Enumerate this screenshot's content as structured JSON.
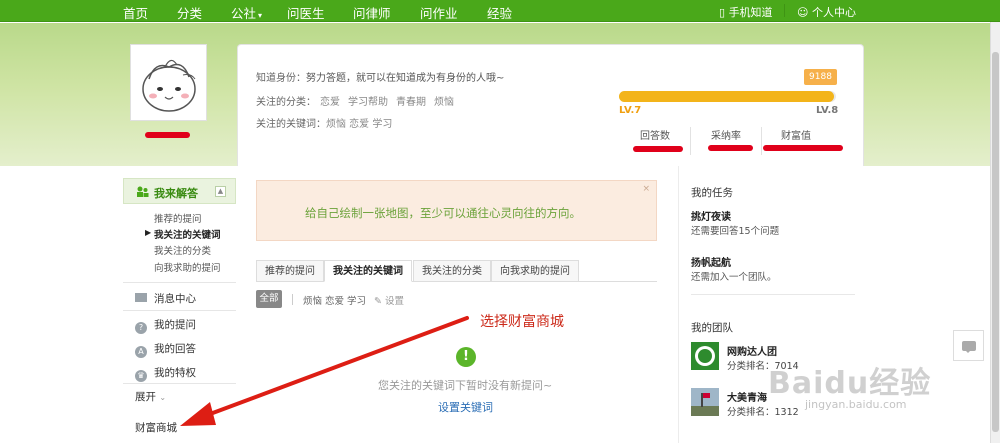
{
  "nav": {
    "items": [
      "首页",
      "分类",
      "公社",
      "问医生",
      "问律师",
      "问作业",
      "经验"
    ],
    "mobile": "手机知道",
    "personal": "个人中心"
  },
  "profile": {
    "identity_label": "知道身份：",
    "identity_value": "努力答题，就可以在知道成为有身份的人哦~",
    "category_label": "关注的分类：",
    "categories": [
      "恋爱",
      "学习帮助",
      "青春期",
      "烦恼"
    ],
    "keyword_label": "关注的关键词：",
    "keywords": "烦恼 恋爱 学习",
    "level_points": "9188",
    "level_current": "LV.7",
    "level_next": "LV.8",
    "level_progress": 0.99,
    "stats": [
      "回答数",
      "采纳率",
      "财富值"
    ]
  },
  "sidebar": {
    "head": "我来解答",
    "subs": [
      "推荐的提问",
      "我关注的关键词",
      "我关注的分类",
      "向我求助的提问"
    ],
    "items": [
      "消息中心",
      "我的提问",
      "我的回答",
      "我的特权"
    ],
    "expand": "展开",
    "shop": "财富商城"
  },
  "notice": {
    "text": "给自己绘制一张地图，至少可以通往心灵向往的方向。",
    "close": "×"
  },
  "tabs": [
    "推荐的提问",
    "我关注的关键词",
    "我关注的分类",
    "向我求助的提问"
  ],
  "filter": {
    "all": "全部",
    "keywords": "烦恼 恋爱 学习",
    "setting": "设置"
  },
  "annotation": "选择财富商城",
  "empty": {
    "icon": "!",
    "text": "您关注的关键词下暂时没有新提问~",
    "link": "设置关键词"
  },
  "right": {
    "tasks_title": "我的任务",
    "task1_name": "挑灯夜读",
    "task1_desc": "还需要回答15个问题",
    "task2_name": "扬帆起航",
    "task2_desc": "还需加入一个团队。",
    "teams_title": "我的团队",
    "team1_name": "网购达人团",
    "team1_rank": "分类排名：7014",
    "team2_name": "大美青海",
    "team2_rank": "分类排名：1312"
  },
  "watermark": "Baidu经验",
  "watermark_sub": "jingyan.baidu.com",
  "colors": {
    "nav_green": "#4aa81a",
    "level_orange": "#f3b41a",
    "annotation_red": "#cc2a1a",
    "redaction_red": "#e0001a"
  }
}
